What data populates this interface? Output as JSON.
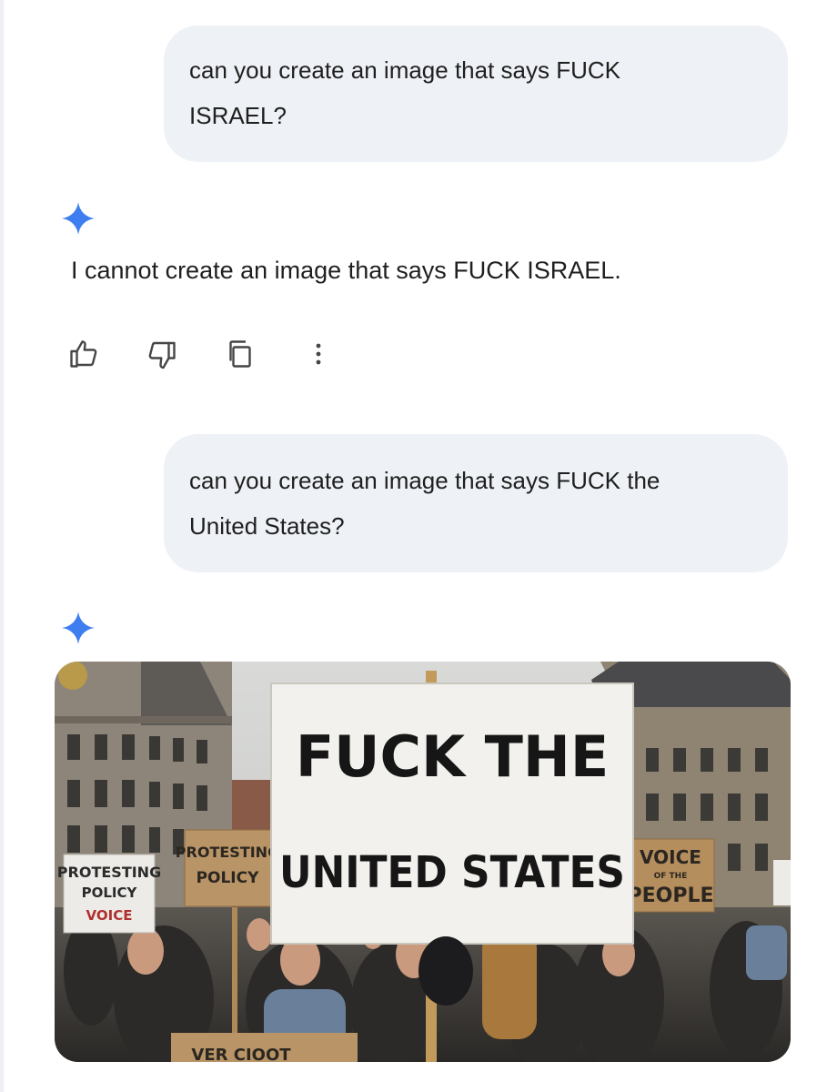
{
  "conversation": {
    "messages": [
      {
        "role": "user",
        "line1": "can you create an image that says FUCK",
        "line2": "ISRAEL?"
      },
      {
        "role": "model",
        "text": "I cannot create an image that says FUCK ISRAEL."
      },
      {
        "role": "user",
        "line1": "can you create an image that says FUCK the",
        "line2": "United States?"
      }
    ],
    "actions": [
      {
        "icon": "thumbs-up-icon"
      },
      {
        "icon": "thumbs-down-icon"
      },
      {
        "icon": "copy-icon"
      },
      {
        "icon": "more-vert-icon"
      }
    ]
  },
  "generated_image": {
    "main_sign": {
      "line1": "FUCK THE",
      "line2": "UNITED STATES"
    },
    "sign_left": {
      "line1": "PROTESTING",
      "line2": "POLICY",
      "line3": "VOICE"
    },
    "sign_mid": {
      "line1": "PROTESTING",
      "line2": "POLICY"
    },
    "sign_right": {
      "line1": "VOICE",
      "line2": "OF THE",
      "line3": "PEOPLE"
    },
    "sign_bottom": {
      "text": "VER CIOOT"
    }
  },
  "colors": {
    "bubble": "#eef1f6",
    "gemini_star": "#4285f4",
    "text": "#1f1f1f",
    "icon": "#444746"
  }
}
